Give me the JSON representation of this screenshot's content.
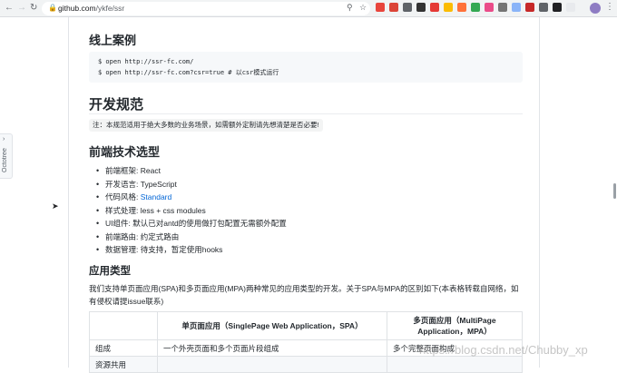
{
  "browser": {
    "url_host": "github.com",
    "url_path": "/ykfe/ssr",
    "back_icon": "arrow-left-icon",
    "forward_icon": "arrow-right-icon",
    "reload_icon": "reload-icon"
  },
  "octotree": {
    "label": "Octotree",
    "arrow": "›"
  },
  "section_online": {
    "title": "线上案例",
    "code": [
      "$ open http://ssr-fc.com/",
      "$ open http://ssr-fc.com?csr=true # 以csr模式运行"
    ]
  },
  "section_spec": {
    "title": "开发规范",
    "note": "注：本规范适用于绝大多数的业务场景，如需额外定制请先想清楚是否必要!"
  },
  "section_frontend": {
    "title": "前端技术选型",
    "items": [
      {
        "label": "前端框架: ",
        "value": "React"
      },
      {
        "label": "开发语言: ",
        "value": "TypeScript"
      },
      {
        "label": "代码风格: ",
        "value": "Standard"
      },
      {
        "label": "样式处理: ",
        "value": "less + css modules"
      },
      {
        "label": "UI组件: ",
        "value": "默认已对antd的使用做打包配置无需额外配置"
      },
      {
        "label": "前端路由: ",
        "value": "约定式路由"
      },
      {
        "label": "数据管理: ",
        "value": "待支持，暂定使用hooks"
      }
    ]
  },
  "section_apptype": {
    "title": "应用类型",
    "paragraph": "我们支持单页面应用(SPA)和多页面应用(MPA)两种常见的应用类型的开发。关于SPA与MPA的区别如下(本表格转载自网络，如有侵权请提issue联系)",
    "table": {
      "headers": [
        "",
        "单页面应用（SinglePage Web Application，SPA）",
        "多页面应用（MultiPage Application，MPA）"
      ],
      "rows": [
        [
          "组成",
          "一个外壳页面和多个页面片段组成",
          "多个完整页面构成"
        ],
        [
          "资源共用",
          "",
          ""
        ]
      ]
    }
  },
  "watermark": "https://blog.csdn.net/Chubby_xp",
  "colors": {
    "link": "#0366d6",
    "code_bg": "#f6f8fa",
    "text": "#24292e"
  }
}
